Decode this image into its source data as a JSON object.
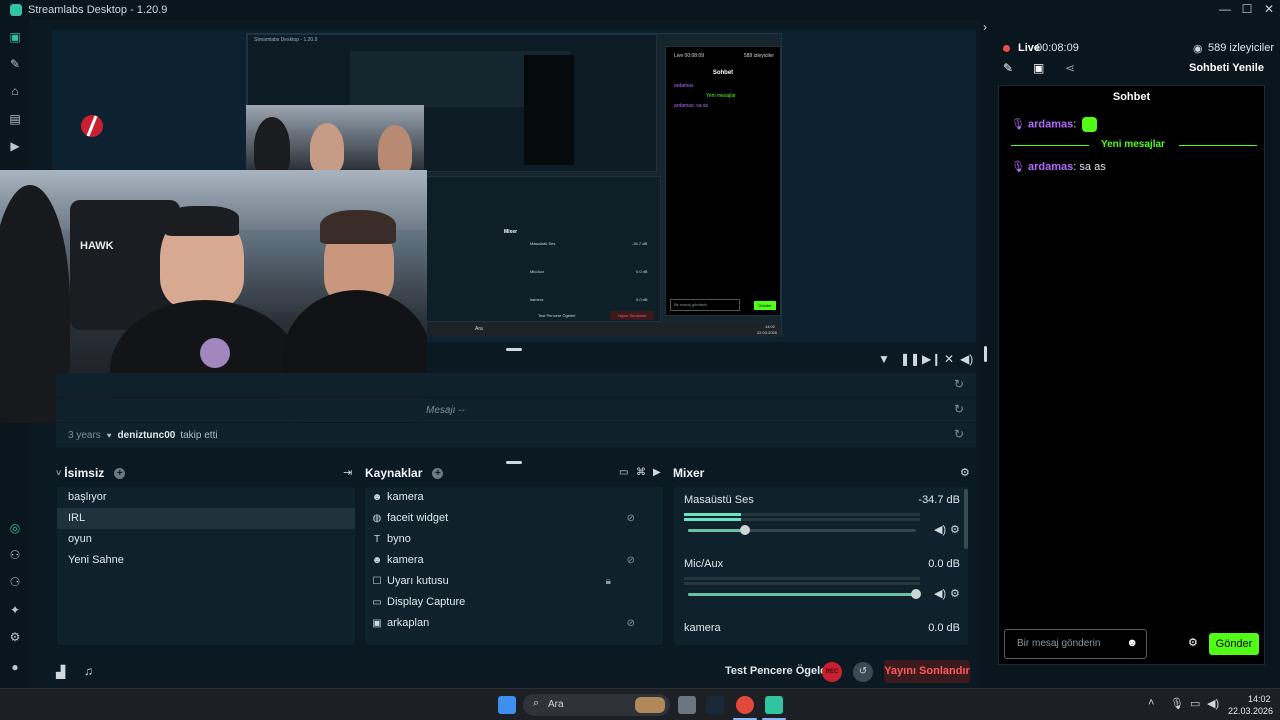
{
  "window": {
    "title": "Streamlabs Desktop - 1.20.9",
    "controls": [
      "—",
      "☐",
      "✕"
    ]
  },
  "sidebar": {
    "top_icons": [
      "studio-icon",
      "themes-icon",
      "store-icon",
      "layout-icon",
      "play-icon"
    ],
    "bottom_icons": [
      "recording-icon",
      "integrations-icon",
      "apps-icon",
      "effects-icon",
      "settings-icon",
      "profile-icon"
    ]
  },
  "preview": {
    "inner_app_title": "Streamlabs Desktop - 1.20.9",
    "inner_chat_header": "Sohbet",
    "inner_chat_lines": [
      "ardamas",
      "Yeni mesajlar",
      "ardamas: sa as"
    ],
    "inner_chat_input": "Bir mesaj gönderin",
    "inner_chat_send": "Gönder",
    "inner_live": "Live 00:08:09",
    "inner_viewers": "589 izleyiciler",
    "inner_mixer": "Mixer",
    "inner_masaustu": "Masaüstü Ses",
    "inner_masaustu_db": "-34.7 dB",
    "inner_mic": "Mic/Aux",
    "inner_mic_db": "0.0 dB",
    "inner_kamera": "kamera",
    "inner_kamera_db": "0.0 dB",
    "inner_test": "Test Pencere Ögeleri",
    "inner_end": "Yayını Sonlandır",
    "inner_search": "Ara",
    "inner_time": "14:02",
    "inner_date": "22.03.2026"
  },
  "activity_feed": {
    "rows": [
      {
        "time": "",
        "user": "",
        "text": ""
      },
      {
        "time": "",
        "user": "",
        "text": "Mesajı --"
      },
      {
        "time": "3 years",
        "user": "deniztunc00",
        "text": "takip etti"
      }
    ]
  },
  "scenes": {
    "title": "İsimsiz",
    "items": [
      "başlıyor",
      "IRL",
      "oyun",
      "Yeni Sahne"
    ],
    "active_index": 1
  },
  "sources": {
    "title": "Kaynaklar",
    "items": [
      {
        "label": "kamera",
        "icon": "camera-icon",
        "hidden": false,
        "locked": false
      },
      {
        "label": "faceit widget",
        "icon": "globe-icon",
        "hidden": true,
        "locked": false
      },
      {
        "label": "byno",
        "icon": "text-icon",
        "hidden": false,
        "locked": false
      },
      {
        "label": "kamera",
        "icon": "camera-icon",
        "hidden": true,
        "locked": false
      },
      {
        "label": "Uyarı kutusu",
        "icon": "alert-icon",
        "hidden": false,
        "locked": true
      },
      {
        "label": "Display Capture",
        "icon": "monitor-icon",
        "hidden": false,
        "locked": false
      },
      {
        "label": "arkaplan",
        "icon": "image-icon",
        "hidden": true,
        "locked": false
      }
    ]
  },
  "mixer": {
    "title": "Mixer",
    "channels": [
      {
        "name": "Masaüstü Ses",
        "db": "-34.7 dB",
        "level": 0.24,
        "volume": 0.25
      },
      {
        "name": "Mic/Aux",
        "db": "0.0 dB",
        "level": 0.0,
        "volume": 1.0
      },
      {
        "name": "kamera",
        "db": "0.0 dB",
        "level": 0.0,
        "volume": 1.0
      }
    ]
  },
  "footer": {
    "test_label": "Test Pencere Ögeleri",
    "rec_label": "REC",
    "end_stream_label": "Yayını Sonlandır"
  },
  "chat": {
    "live_label": "Live",
    "live_time": "00:08:09",
    "viewers": "589 izleyiciler",
    "refresh_label": "Sohbeti Yenile",
    "header": "Sohbet",
    "messages": [
      {
        "user": "ardamas",
        "text": ":",
        "emote": true
      },
      {
        "divider": "Yeni mesajlar"
      },
      {
        "user": "ardamas",
        "text": ": sa as",
        "emote": false
      }
    ],
    "input_placeholder": "Bir mesaj gönderin",
    "send_label": "Gönder",
    "accent": "#53fc18",
    "user_color": "#b36bff"
  },
  "taskbar": {
    "search_placeholder": "Ara",
    "time": "14:02",
    "date": "22.03.2026"
  }
}
